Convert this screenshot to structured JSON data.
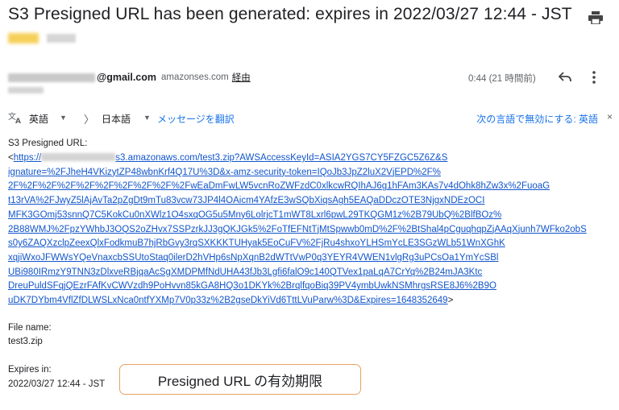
{
  "email": {
    "subject": "S3 Presigned URL has been generated: expires in 2022/03/27 12:44 - JST",
    "sender": {
      "email_suffix": "@gmail.com",
      "via_domain": "amazonses.com",
      "via_label": "経由"
    },
    "time": "0:44 (21 時間前)"
  },
  "translate_bar": {
    "source_lang": "英語",
    "target_lang": "日本語",
    "arrow": "〉",
    "translate_link": "メッセージを翻訳",
    "never_translate": "次の言語で無効にする: 英語",
    "close": "×"
  },
  "message": {
    "intro": "S3 Presigned URL:",
    "url_prefix": "<https://",
    "url_lines": [
      "s3.amazonaws.com/test3.zip?AWSAccessKeyId=ASIA2YGS7CY5FZGC5Z6Z&S",
      "ignature=%2FJheH4VKizytZP48wbnKrf4Q17U%3D&x-amz-security-token=IQoJb3JpZ2luX2VjEPD%2F%",
      "2F%2F%2F%2F%2F%2F%2F%2F%2F%2FwEaDmFwLW5vcnRoZWFzdC0xlkcwRQIhAJ6g1hFAm3KAs7v4dOhk8hZw3x%2FuoaG",
      "t13rVA%2FJwyZ5lAjAvTa2pZgDt9mTu83vcw73JP4l4OAicm4YAfzE3wSQbXiqsAgh5EAQaDDczOTE3NjgxNDEzOCI",
      "MFK3GOmj53snnQ7C5KokCu0nXWlz1O4sxqOG5u5Mny6LolrjcT1mWT8Lxrl6pwL29TKQGM1z%2B79UbQ%2BlfBOz%",
      "2B88WMJ%2FpzYWhbJ3OQS2oZHvx7SSPzrkJJ3gQKJGk5%2FoTfEFNtTjMtSpwwb0mD%2F%2BtShal4pCguqhqpZjAAqXjunh7WFko2obS",
      "s0y6ZAQXzclpZeexQlxFodkmuB7hjRbGvy3rqSXKKKTUHyak5EoCuFV%2FjRu4shxoYLHSmYcLE3SGzWLb51WnXGhK",
      "xqjiWxoJFWWsYQeVnaxcbSSUtoStaq0ilerD2hVHp6sNpXqnB2dWTtVwP0q3YEYR4VWEN1vlgRg3uPCsOa1YmYcSBl",
      "UBi980IRmzY9TNN3zDlxveRBjqaAcSgXMDPMfNdUHA43fJb3Lgfi6falO9c140QTVex1paLqA7CrYq%2B24mJA3Ktc",
      "DreuPuldSFqjQEzrFAfKvCWVzdh9PoHvvn85kGA8HQ3o1DKYk%2BrqlfqoBiq39PV4ymbUwkNSMhrgsRSE8J6%2B9O",
      "uDK7DYbm4VflZfDLWSLxNca0ntfYXMp7V0p33z%2B2gseDkYiVd6TttLVuParw%3D&Expires=1648352649"
    ],
    "url_suffix": ">",
    "file_name_label": "File name:",
    "file_name": "test3.zip",
    "expires_label": "Expires in:",
    "expires_value": "2022/03/27 12:44 - JST"
  },
  "annotation": {
    "callout_text": "Presigned URL の有効期限",
    "border_color": "#e8a263"
  },
  "icons": [
    "print-icon",
    "translate-icon",
    "reply-icon",
    "more-vert-icon",
    "close-icon"
  ],
  "colors": {
    "link": "#1155cc",
    "accent_link": "#1a73e8",
    "redaction_yellow": "#f4c430"
  }
}
